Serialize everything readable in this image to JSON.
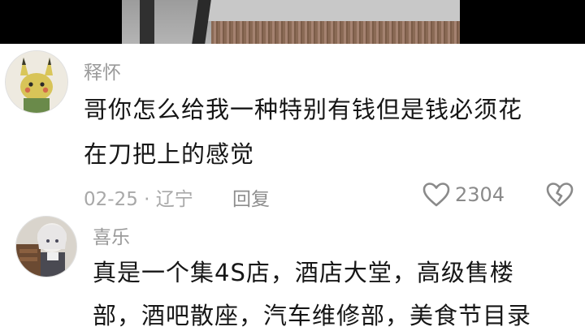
{
  "comments": [
    {
      "username": "释怀",
      "text_lines": [
        "哥你怎么给我一种特别有钱但是钱必须花",
        "在刀把上的感觉"
      ],
      "date": "02-25",
      "location": "辽宁",
      "reply_label": "回复",
      "like_count": "2304",
      "avatar_icon": "pikachu-avatar"
    },
    {
      "username": "喜乐",
      "text_lines": [
        "真是一个集4S店，酒店大堂，高级售楼",
        "部，酒吧散座，汽车维修部，美食节目录"
      ],
      "avatar_icon": "anime-character-avatar"
    }
  ],
  "colors": {
    "username": "#9a9a9a",
    "text": "#161616",
    "meta": "#a8a8a8"
  }
}
